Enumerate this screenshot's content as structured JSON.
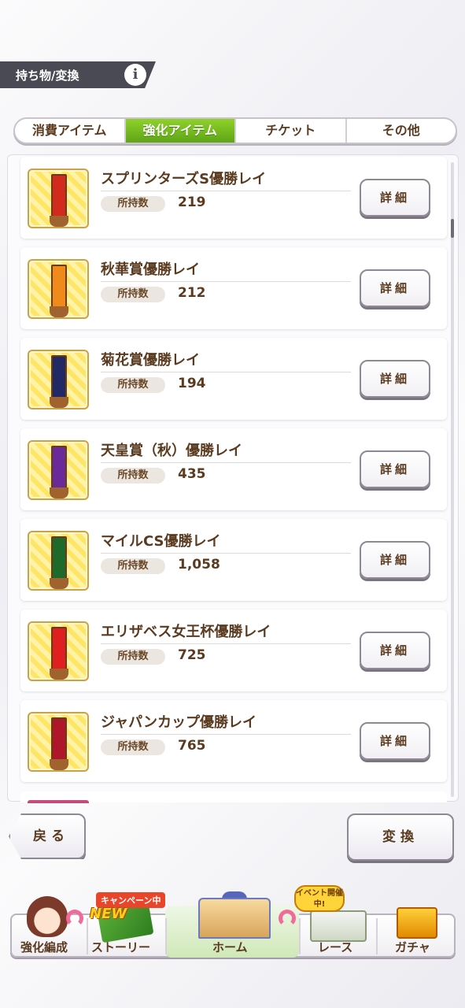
{
  "header": {
    "title": "持ち物/変換",
    "info_icon": "i"
  },
  "tabs": [
    {
      "label": "消費アイテム",
      "active": false
    },
    {
      "label": "強化アイテム",
      "active": true
    },
    {
      "label": "チケット",
      "active": false
    },
    {
      "label": "その他",
      "active": false
    }
  ],
  "items": [
    {
      "name": "スプリンターズS優勝レイ",
      "count_label": "所持数",
      "count": "219",
      "detail_label": "詳細",
      "ribbon_color": "#d32a1e"
    },
    {
      "name": "秋華賞優勝レイ",
      "count_label": "所持数",
      "count": "212",
      "detail_label": "詳細",
      "ribbon_color": "#f08a1a"
    },
    {
      "name": "菊花賞優勝レイ",
      "count_label": "所持数",
      "count": "194",
      "detail_label": "詳細",
      "ribbon_color": "#222a66"
    },
    {
      "name": "天皇賞（秋）優勝レイ",
      "count_label": "所持数",
      "count": "435",
      "detail_label": "詳細",
      "ribbon_color": "#6a2a9a"
    },
    {
      "name": "マイルCS優勝レイ",
      "count_label": "所持数",
      "count": "1,058",
      "detail_label": "詳細",
      "ribbon_color": "#1e6a2a"
    },
    {
      "name": "エリザベス女王杯優勝レイ",
      "count_label": "所持数",
      "count": "725",
      "detail_label": "詳細",
      "ribbon_color": "#e02020"
    },
    {
      "name": "ジャパンカップ優勝レイ",
      "count_label": "所持数",
      "count": "765",
      "detail_label": "詳細",
      "ribbon_color": "#b0162a"
    }
  ],
  "buttons": {
    "back": "戻る",
    "convert": "変換"
  },
  "nav": [
    {
      "label": "強化編成",
      "icon": "character-icon"
    },
    {
      "label": "ストーリー",
      "icon": "book-icon",
      "tag": "キャンペーン中",
      "badge": "NEW"
    },
    {
      "label": "ホーム",
      "icon": "building-icon"
    },
    {
      "label": "レース",
      "icon": "race-icon",
      "tag": "イベント開催中!"
    },
    {
      "label": "ガチャ",
      "icon": "gacha-icon"
    }
  ]
}
